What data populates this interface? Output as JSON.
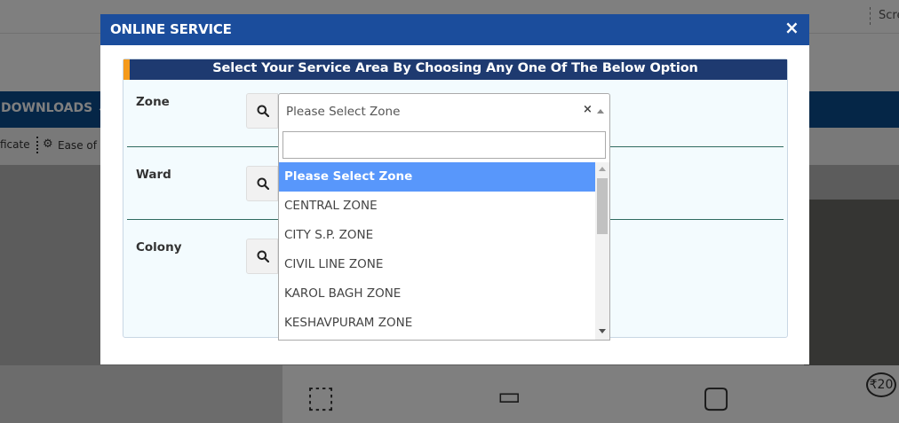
{
  "background": {
    "top_right_text": "Scre",
    "nav_text": "DOWNLOADS ⌄",
    "subnav_left_text": "ficate",
    "subnav_right_text": "Ease of I",
    "gear_icon": "⚙",
    "bottom_coin": "₹20"
  },
  "modal": {
    "title": "ONLINE SERVICE",
    "close_icon": "×",
    "panel_title": "Select Your Service Area By Choosing Any One Of The Below Option",
    "fields": [
      {
        "label": "Zone"
      },
      {
        "label": "Ward"
      },
      {
        "label": "Colony"
      }
    ],
    "zone_select": {
      "value": "Please Select Zone",
      "clear_icon": "×",
      "search_placeholder": "",
      "options": [
        "Please Select Zone",
        "CENTRAL ZONE",
        "CITY S.P. ZONE",
        "CIVIL LINE ZONE",
        "KAROL BAGH ZONE",
        "KESHAVPURAM ZONE"
      ],
      "highlighted_index": 0
    }
  },
  "colors": {
    "modal_header": "#1b4d9c",
    "panel_header": "#1e3a70",
    "panel_accent": "#f59a1b",
    "selected_option": "#5897fb",
    "nav_bar": "#0a4c8f"
  }
}
